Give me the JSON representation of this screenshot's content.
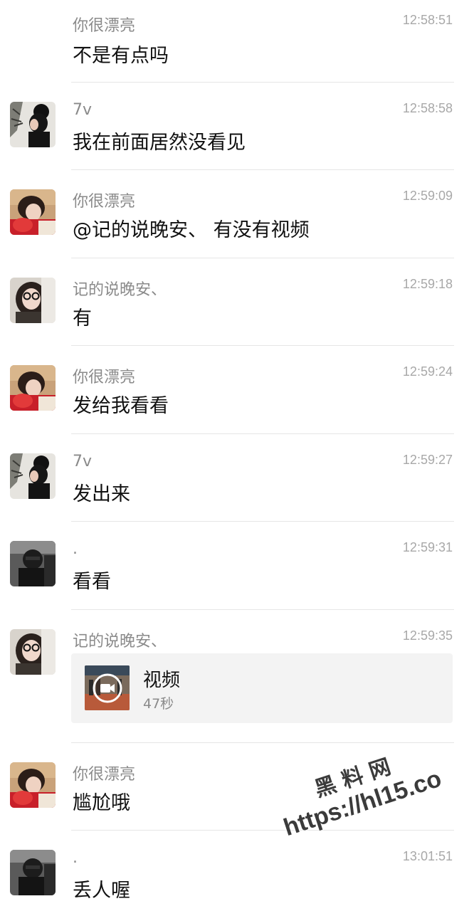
{
  "messages": [
    {
      "sender": "你很漂亮",
      "time": "12:58:51",
      "text": "不是有点吗",
      "avatar": "girl-red-icon"
    },
    {
      "sender": "7v",
      "time": "12:58:58",
      "text": "我在前面居然没看见",
      "avatar": "girl-bun-icon"
    },
    {
      "sender": "你很漂亮",
      "time": "12:59:09",
      "text": "@记的说晚安、 有没有视频",
      "avatar": "girl-red-icon"
    },
    {
      "sender": "记的说晚安、",
      "time": "12:59:18",
      "text": "有",
      "avatar": "girl-glasses-icon"
    },
    {
      "sender": "你很漂亮",
      "time": "12:59:24",
      "text": "发给我看看",
      "avatar": "girl-red-icon"
    },
    {
      "sender": "7v",
      "time": "12:59:27",
      "text": "发出来",
      "avatar": "girl-bun-icon"
    },
    {
      "sender": ".",
      "time": "12:59:31",
      "text": "看看",
      "avatar": "dark-person-icon"
    },
    {
      "sender": "记的说晚安、",
      "time": "12:59:35",
      "avatar": "girl-glasses-icon",
      "video": {
        "title": "视频",
        "duration": "47秒",
        "icon": "video-camera-icon"
      }
    },
    {
      "sender": "你很漂亮",
      "time": "",
      "text": "尴尬哦",
      "avatar": "girl-red-icon"
    },
    {
      "sender": ".",
      "time": "13:01:51",
      "text": "丢人喔",
      "avatar": "dark-person-icon"
    }
  ],
  "watermark": {
    "line1": "黑料网",
    "line2": "https://hl15.co"
  },
  "colors": {
    "name": "#8a8a8a",
    "time": "#a8a8a8",
    "text": "#111111",
    "divider": "#e6e6e6",
    "card": "#f3f3f3"
  }
}
